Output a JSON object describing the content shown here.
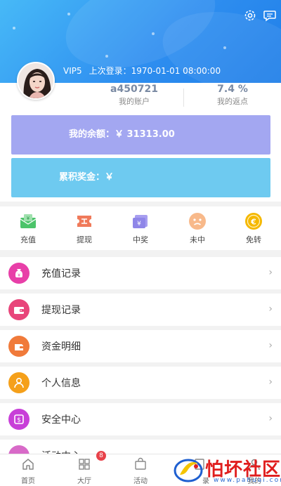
{
  "header": {
    "vip_level": "VIP5",
    "last_login": "上次登录：1970-01-01 08:00:00"
  },
  "account": {
    "username": "a450721",
    "username_label": "我的账户",
    "rebate": "7.4 %",
    "rebate_label": "我的返点"
  },
  "balance": {
    "label": "我的余额：￥ 31313.00",
    "bonus_label": "累积奖金：￥",
    "balance_color": "#a3a7f1",
    "bonus_color": "#6ecaf0"
  },
  "actions": [
    {
      "label": "充值",
      "icon": "money-envelope-icon",
      "color": "#4cc46a"
    },
    {
      "label": "提现",
      "icon": "withdraw-ticket-icon",
      "color": "#f07a5a"
    },
    {
      "label": "中奖",
      "icon": "yen-bag-icon",
      "color": "#8f86e8"
    },
    {
      "label": "未中",
      "icon": "sad-face-icon",
      "color": "#f5a46a"
    },
    {
      "label": "免转",
      "icon": "coin-icon",
      "color": "#f5b800"
    }
  ],
  "menu": [
    {
      "label": "充值记录",
      "icon": "moneybag-icon",
      "color": "#e83fa8"
    },
    {
      "label": "提现记录",
      "icon": "wallet-icon",
      "color": "#e8457a"
    },
    {
      "label": "资金明细",
      "icon": "purse-icon",
      "color": "#f07a3a"
    },
    {
      "label": "个人信息",
      "icon": "user-icon",
      "color": "#f5a01a"
    },
    {
      "label": "安全中心",
      "icon": "dollar-card-icon",
      "color": "#c83fd8"
    },
    {
      "label": "活动中心",
      "icon": "gift-icon",
      "color": "#d86ac8"
    }
  ],
  "bottom_nav": [
    {
      "label": "首页",
      "icon": "home-icon"
    },
    {
      "label": "大厅",
      "icon": "grid-icon",
      "badge": "8"
    },
    {
      "label": "活动",
      "icon": "bag-icon"
    },
    {
      "label": "录",
      "icon": "record-icon"
    },
    {
      "label": "我的",
      "icon": "profile-icon"
    }
  ],
  "watermark": {
    "text": "怕坏社区",
    "url": "www.pahuai.com"
  }
}
